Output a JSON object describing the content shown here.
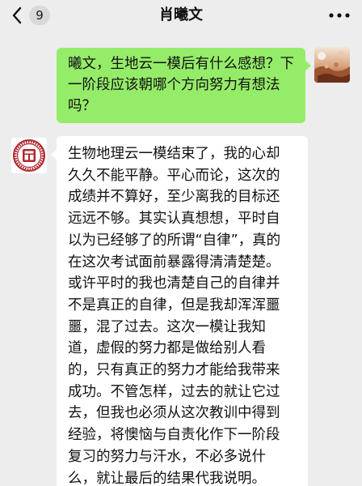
{
  "header": {
    "back_icon": "chevron-left-icon",
    "unread_count": "9",
    "title": "肖曦文",
    "more_icon": "more-dots-icon"
  },
  "messages": [
    {
      "direction": "sent",
      "avatar": "photo-avatar",
      "text": "曦文，生地云一模后有什么感想？下一阶段应该朝哪个方向努力有想法吗？"
    },
    {
      "direction": "received",
      "avatar": "university-seal-avatar",
      "text": "生物地理云一模结束了，我的心却\n久久不能平静。平心而论，这次的\n成绩并不算好，至少离我的目标还\n远远不够。其实认真想想，平时自\n以为已经够了的所谓“自律”，真的\n在这次考试面前暴露得清清楚楚。\n或许平时的我也清楚自己的自律并\n不是真正的自律，但是我却浑浑噩\n噩，混了过去。这次一模让我知\n道，虚假的努力都是做给别人看\n的，只有真正的努力才能给我带来\n成功。不管怎样，过去的就让它过\n去，但我也必须从这次教训中得到\n经验，将懊恼与自责化作下一阶段\n复习的努力与汗水，不必多说什\n么，就让最后的结果代我说明。"
    }
  ],
  "colors": {
    "background": "#ededed",
    "sent_bubble": "#95ec69",
    "received_bubble": "#ffffff",
    "seal_red": "#b3262e"
  }
}
